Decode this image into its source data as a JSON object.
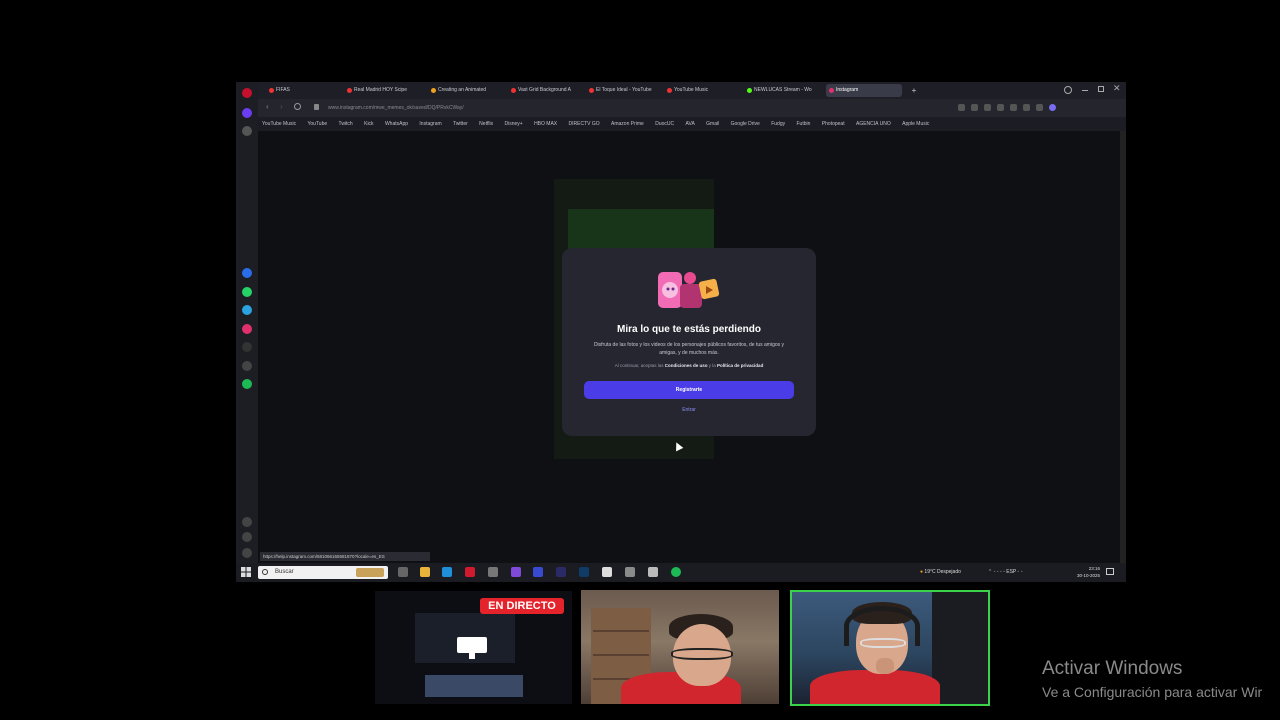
{
  "browser": {
    "tabs": [
      {
        "label": "FIFAS"
      },
      {
        "label": "Real Madrid HOY Scipe"
      },
      {
        "label": "Creating an Animated"
      },
      {
        "label": "Vast Grid Background A"
      },
      {
        "label": "El Toque Ideal - YouTube"
      },
      {
        "label": "YouTube Music"
      },
      {
        "label": "NEWLUCAS Stream - Wo"
      },
      {
        "label": "Instagram"
      }
    ],
    "url": "www.instagram.com/mwe_memes_ok/saved/DQ/PRvkCWay/",
    "bookmarks": [
      "YouTube Music",
      "YouTube",
      "Twitch",
      "Kick",
      "WhatsApp",
      "Instagram",
      "Twitter",
      "Netflix",
      "Disney+",
      "HBO MAX",
      "DIRECTV GO",
      "Amazon Prime",
      "DuocUC",
      "AVA",
      "Gmail",
      "Google Drive",
      "Fudgy",
      "Futbin",
      "Photopeat",
      "AGENCIA UNO",
      "Apple Music"
    ],
    "status_url": "https://help.instagram.com/581066165581870?locale=es_ES"
  },
  "modal": {
    "title": "Mira lo que te estás perdiendo",
    "body": "Disfruta de las fotos y los videos de los personajes públicos favoritos, de tus amigos y amigas, y de muchos más.",
    "terms_prefix": "Al continuar, aceptas las",
    "terms_link": "Condiciones de uso",
    "terms_mid": "y la",
    "privacy_link": "Política de privacidad",
    "signup_label": "Registrarte",
    "login_label": "Entrar",
    "accent": "#4a3de8"
  },
  "taskbar": {
    "search_placeholder": "Buscar",
    "weather": "19°C Despejado",
    "language": "ESP",
    "time": "23:16",
    "date": "30-10-2025"
  },
  "stream": {
    "live_label": "EN DIRECTO",
    "live_color": "#e5232a",
    "active_cam_border": "#3bd14a"
  },
  "watermark": {
    "title": "Activar Windows",
    "subtitle": "Ve a Configuración para activar Wir"
  }
}
